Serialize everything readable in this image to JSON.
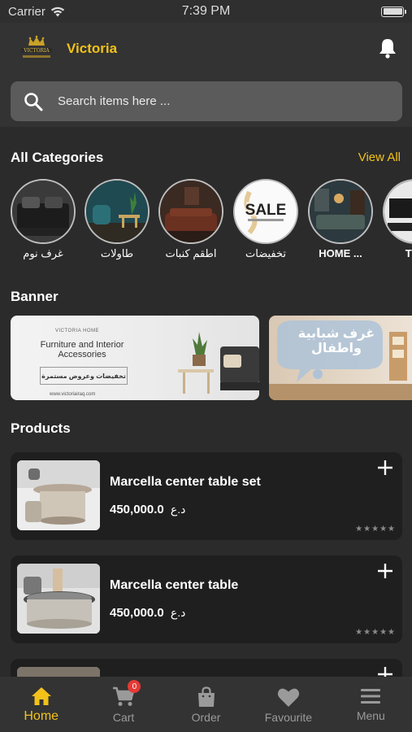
{
  "status_bar": {
    "carrier": "Carrier",
    "time": "7:39 PM"
  },
  "header": {
    "brand": "Victoria",
    "logo_text": "VICTORIA",
    "search_placeholder": "Search items here ..."
  },
  "categories_section": {
    "title": "All Categories",
    "view_all": "View All",
    "items": [
      {
        "label": "غرف نوم",
        "icon": "bedroom-photo"
      },
      {
        "label": "طاولات",
        "icon": "tables-photo"
      },
      {
        "label": "اطقم كنبات",
        "icon": "sofas-photo"
      },
      {
        "label": "تخفيضات",
        "icon": "sale-photo"
      },
      {
        "label": "HOME ...",
        "icon": "home-photo"
      },
      {
        "label": "TV t",
        "icon": "tv-photo"
      }
    ]
  },
  "banner_section": {
    "title": "Banner",
    "banners": [
      {
        "brand": "VICTORIA HOME",
        "title": "Furniture and Interior Accessories",
        "subtitle": "تخفيضات وعروض مستمرة",
        "url": "www.victoriairaq.com"
      },
      {
        "title": "غرف شبابية واطفال"
      }
    ]
  },
  "products_section": {
    "title": "Products",
    "items": [
      {
        "name": "Marcella center table set",
        "price": "450,000.0",
        "currency": "د.ع",
        "stars": "★★★★★"
      },
      {
        "name": "Marcella center table",
        "price": "450,000.0",
        "currency": "د.ع",
        "stars": "★★★★★"
      },
      {
        "name": "",
        "price": "",
        "currency": "",
        "stars": ""
      }
    ]
  },
  "tabbar": {
    "tabs": [
      {
        "label": "Home",
        "icon": "home-icon",
        "active": true
      },
      {
        "label": "Cart",
        "icon": "cart-icon",
        "badge": "0"
      },
      {
        "label": "Order",
        "icon": "bag-icon"
      },
      {
        "label": "Favourite",
        "icon": "heart-icon"
      },
      {
        "label": "Menu",
        "icon": "menu-icon"
      }
    ]
  },
  "colors": {
    "accent": "#f2c21b",
    "background": "#2b2b2b",
    "card": "#1f1f1f",
    "badge": "#e53935"
  }
}
